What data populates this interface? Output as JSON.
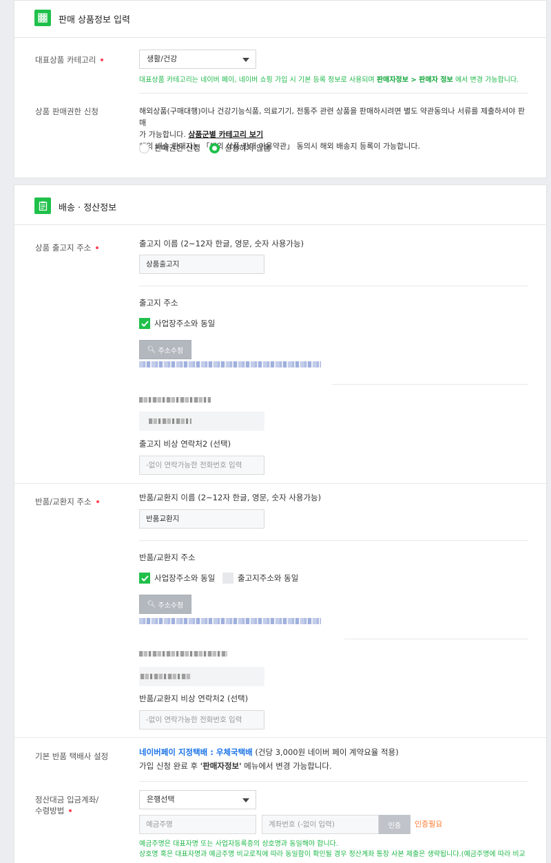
{
  "section1": {
    "title": "판매 상품정보 입력",
    "category_label": "대표상품 카테고리",
    "category_value": "생활/건강",
    "category_help_prefix": "대표상품 카테고리는 네이버 페이, 네이버 쇼핑 가입 시 기본 등록 정보로 사용되며",
    "category_help_bold": "판매자정보 > 판매자 정보",
    "category_help_suffix": "에서 변경 가능합니다.",
    "permission_label": "상품 판매권한 신청",
    "permission_desc1": "해외상품(구매대행)이나 건강기능식품, 의료기기, 전통주 관련 상품을 판매하시려면 별도 약관동의나 서류를 제출하셔야 판매",
    "permission_desc2_prefix": "가 가능합니다.",
    "permission_link": "상품군별 카테고리 보기",
    "permission_desc3": "해외 배송 판매자는 「해외 상품 판매 이용약관」 동의시 해외 배송지 등록이 가능합니다.",
    "radio_apply": "판매권한 신청",
    "radio_no": "신청하지 않음"
  },
  "section2": {
    "title": "배송 · 정산정보",
    "ship_label": "상품 출고지 주소",
    "ship_name_label": "출고지 이름 (2~12자 한글, 영문, 숫자 사용가능)",
    "ship_name_value": "상품출고지",
    "ship_addr_label": "출고지 주소",
    "same_business": "사업장주소와 동일",
    "addr_edit": "주소수정",
    "ship_contact2_label": "출고지 비상 연락처2 (선택)",
    "contact_placeholder": "-없이 연락가능한 전화번호 입력",
    "return_label": "반품/교환지 주소",
    "return_name_label": "반품/교환지 이름 (2~12자 한글, 영문, 숫자 사용가능)",
    "return_name_value": "반품교환지",
    "return_addr_label": "반품/교환지 주소",
    "same_ship": "출고지주소와 동일",
    "return_contact2_label": "반품/교환지 비상 연락처2 (선택)",
    "courier_label": "기본 반품 택배사 설정",
    "courier_blue": "네이버페이 지정택배 : 우체국택배",
    "courier_rest": "(건당 3,000원 네이버 페이 계약요율 적용)",
    "courier_note_prefix": "가입 신청 완료 후",
    "courier_note_bold": "'판매자정보'",
    "courier_note_suffix": "메뉴에서 변경 가능합니다.",
    "settle_label1": "정산대금 입금계좌/",
    "settle_label2": "수령방법",
    "bank_select": "은행선택",
    "holder_placeholder": "예금주명",
    "account_placeholder": "계좌번호 (-없이 입력)",
    "verify_button": "인증",
    "verify_needed": "인증필요",
    "settle_help1": "예금주명은 대표자명 또는 사업자등록증의 상호명과 동일해야 합니다.",
    "settle_help2": "상호명 혹은 대표자명과 예금주명 비교로직에 따라 동일함이 확인될 경우 정산계좌 통장 사본 제출은 생략됩니다.(예금주명에 따라 비교"
  },
  "colors": {
    "accent": "#1fc04a",
    "required": "#ff4256",
    "link_blue": "#1a73e8",
    "warn": "#ff7a2f"
  }
}
